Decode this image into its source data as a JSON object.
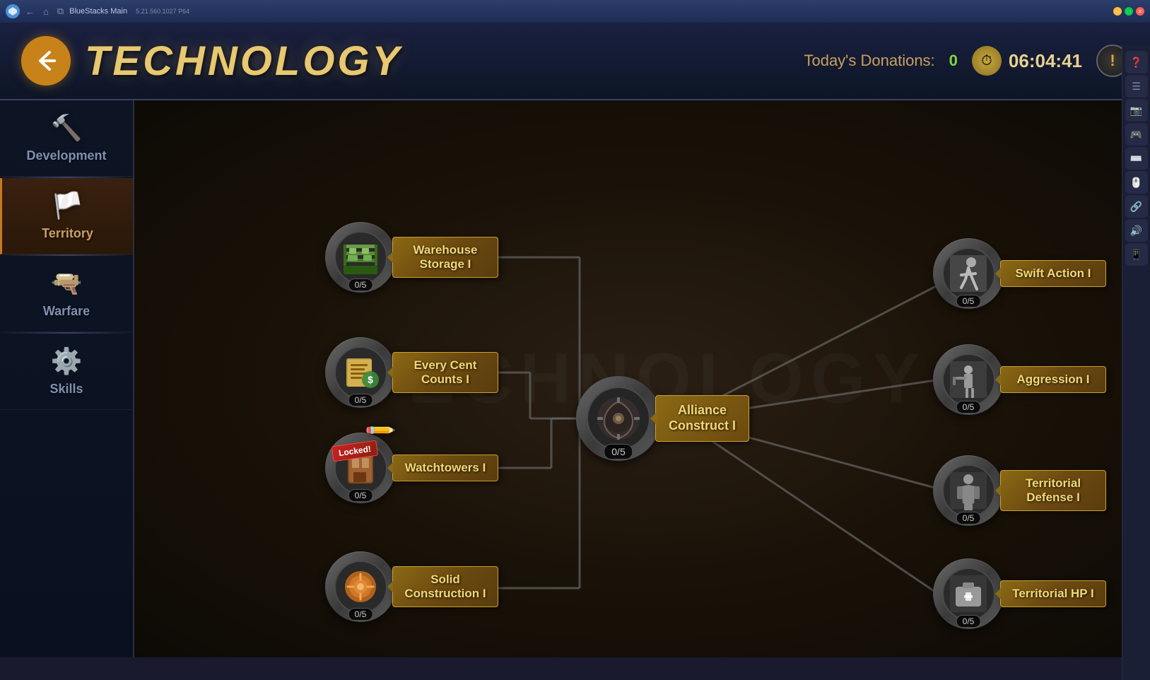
{
  "titlebar": {
    "app_name": "BlueStacks Main",
    "version": "5.21.560.1027  P64",
    "nav_back": "←",
    "nav_home": "⌂",
    "nav_pages": "⧉"
  },
  "header": {
    "title": "TECHNOLOGY",
    "back_label": "←",
    "donations_label": "Today's Donations:",
    "donations_value": "0",
    "timer_value": "06:04:41",
    "alert_label": "!"
  },
  "nav": {
    "items": [
      {
        "id": "development",
        "label": "Development",
        "icon": "🔨",
        "active": false
      },
      {
        "id": "territory",
        "label": "Territory",
        "icon": "🏳️",
        "active": true
      },
      {
        "id": "warfare",
        "label": "Warfare",
        "icon": "🔫",
        "active": false
      },
      {
        "id": "skills",
        "label": "Skills",
        "icon": "⚙️",
        "active": false
      }
    ]
  },
  "tech_nodes": {
    "warehouse_storage": {
      "label": "Warehouse\nStorage I",
      "progress": "0/5",
      "icon": "📦",
      "locked": false
    },
    "every_cent": {
      "label": "Every Cent\nCounts I",
      "progress": "0/5",
      "icon": "📋",
      "locked": false
    },
    "watchtowers": {
      "label": "Watchtowers I",
      "progress": "0/5",
      "icon": "📜",
      "locked": true,
      "locked_label": "Locked!"
    },
    "solid_construction": {
      "label": "Solid\nConstruction I",
      "progress": "0/5",
      "icon": "🏗️",
      "locked": false
    },
    "alliance_construct": {
      "label": "Alliance\nConstruct I",
      "progress": "0/5",
      "icon": "⚙️",
      "locked": false,
      "center": true
    },
    "swift_action": {
      "label": "Swift Action I",
      "progress": "0/5",
      "icon": "🏃",
      "locked": false
    },
    "aggression": {
      "label": "Aggression I",
      "progress": "0/5",
      "icon": "👊",
      "locked": false
    },
    "territorial_defense": {
      "label": "Territorial\nDefense I",
      "progress": "0/5",
      "icon": "🛡️",
      "locked": false
    },
    "territorial_hp": {
      "label": "Territorial HP I",
      "progress": "0/5",
      "icon": "💼",
      "locked": false
    }
  },
  "watermark": "TECHNOLOGY",
  "right_sidebar_icons": [
    "❓",
    "☰",
    "📷",
    "🎮",
    "⌨️",
    "🖱️",
    "🔗",
    "🎵",
    "📱"
  ]
}
